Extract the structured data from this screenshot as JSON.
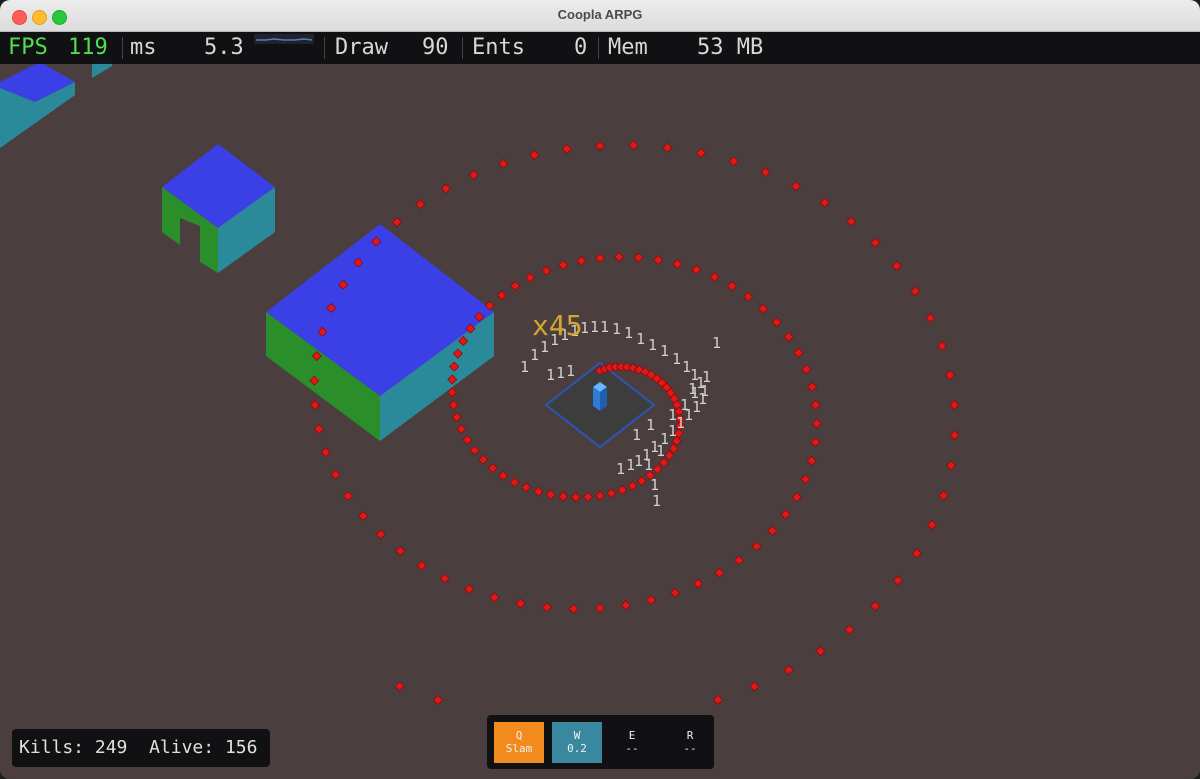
{
  "window": {
    "title": "Coopla ARPG"
  },
  "hud": {
    "fps_label": "FPS",
    "fps_value": "119",
    "ms_label": "ms",
    "ms_value": "5.3",
    "draw_label": "Draw",
    "draw_value": "90",
    "ents_label": "Ents",
    "ents_value": "0",
    "mem_label": "Mem",
    "mem_value": "53 MB"
  },
  "stats": {
    "kills_label": "Kills:",
    "kills": "249",
    "alive_label": "Alive:",
    "alive": "156"
  },
  "skills": [
    {
      "key": "Q",
      "name": "Slam",
      "state": "active"
    },
    {
      "key": "W",
      "name": "0.2",
      "state": "cooldown"
    },
    {
      "key": "E",
      "name": "--",
      "state": "empty"
    },
    {
      "key": "R",
      "name": "--",
      "state": "empty"
    }
  ],
  "combo": {
    "text": "x45"
  },
  "damage_number": "1",
  "colors": {
    "ground": "#4a3f3e",
    "enemy": "#e01818",
    "player": "#2e7bd8",
    "block_top": "#3b3fe6",
    "block_left": "#2a8f2a",
    "block_right": "#2b8a9a",
    "combo": "#d4a630",
    "q_skill": "#f28a1e",
    "w_skill": "#3a87a0",
    "fps_green": "#4ee04e"
  }
}
